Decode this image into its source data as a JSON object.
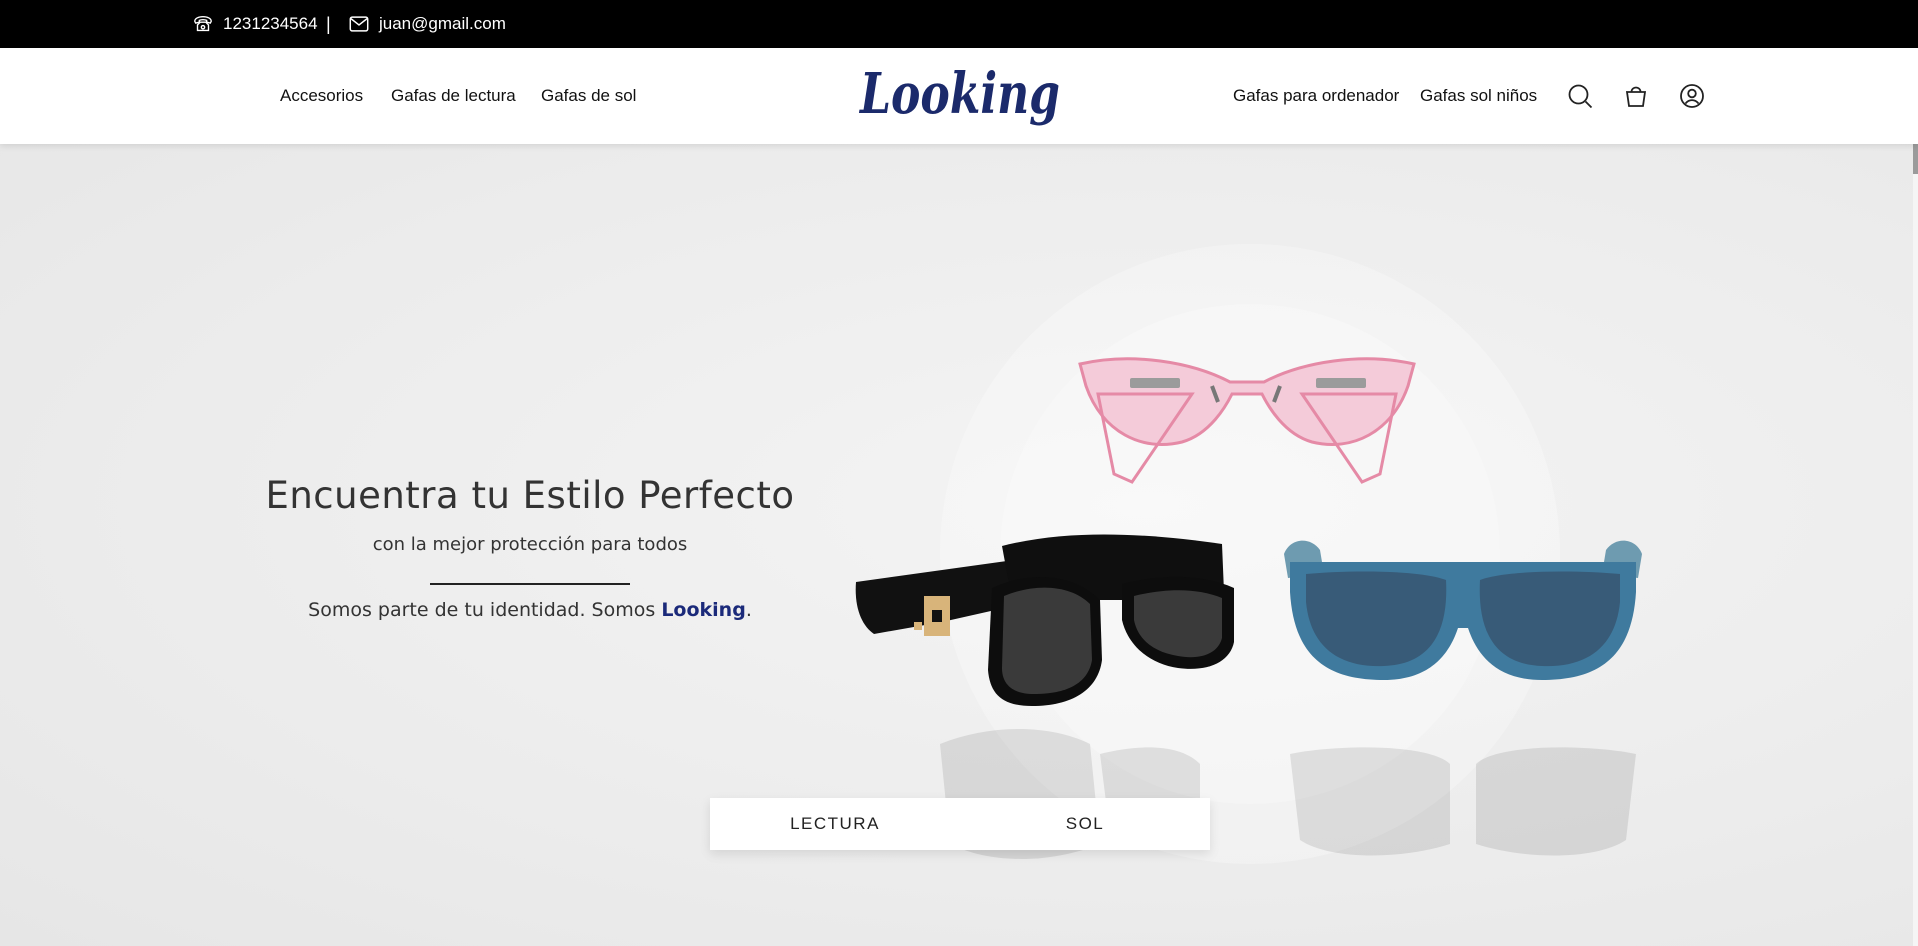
{
  "topbar": {
    "phone": "1231234564",
    "separator": "|",
    "email": "juan@gmail.com",
    "phone_icon": "phone-icon",
    "email_icon": "envelope-icon"
  },
  "header": {
    "nav_left": [
      "Accesorios",
      "Gafas de lectura",
      "Gafas de sol"
    ],
    "logo_text": "Looking",
    "nav_right": [
      "Gafas para ordenador",
      "Gafas sol niños"
    ],
    "icons": [
      "search-icon",
      "shopping-bag-icon",
      "user-icon"
    ],
    "brand_color": "#1b2a6b"
  },
  "hero": {
    "title": "Encuentra tu Estilo Perfecto",
    "subtitle": "con la mejor protección para todos",
    "tagline_prefix": "Somos parte de tu identidad. Somos ",
    "tagline_brand": "Looking",
    "tagline_suffix": ".",
    "brand_accent": "#1b2a7a",
    "products": [
      "pink-reading-glasses",
      "black-square-sunglasses",
      "blue-sunglasses"
    ]
  },
  "tabs": [
    "LECTURA",
    "SOL"
  ]
}
